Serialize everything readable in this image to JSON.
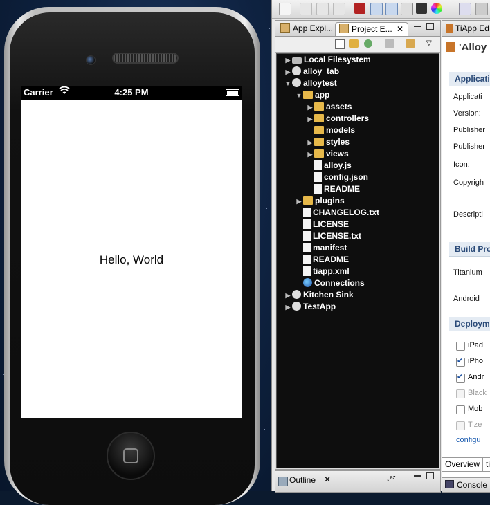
{
  "simulator": {
    "carrier": "Carrier",
    "time": "4:25 PM",
    "screen_text": "Hello, World"
  },
  "project_pane": {
    "tabs": [
      {
        "label": "App Expl..."
      },
      {
        "label": "Project E...",
        "close": "✕"
      }
    ],
    "tree": [
      {
        "label": "Local Filesystem",
        "depth": 0,
        "arrow": "▶",
        "icon": "disk"
      },
      {
        "label": "alloy_tab",
        "depth": 0,
        "arrow": "▶",
        "icon": "project"
      },
      {
        "label": "alloytest",
        "depth": 0,
        "arrow": "▼",
        "icon": "project"
      },
      {
        "label": "app",
        "depth": 1,
        "arrow": "▼",
        "icon": "folder"
      },
      {
        "label": "assets",
        "depth": 2,
        "arrow": "▶",
        "icon": "folder"
      },
      {
        "label": "controllers",
        "depth": 2,
        "arrow": "▶",
        "icon": "folder"
      },
      {
        "label": "models",
        "depth": 2,
        "arrow": "",
        "icon": "folder"
      },
      {
        "label": "styles",
        "depth": 2,
        "arrow": "▶",
        "icon": "folder"
      },
      {
        "label": "views",
        "depth": 2,
        "arrow": "▶",
        "icon": "folder"
      },
      {
        "label": "alloy.js",
        "depth": 2,
        "arrow": "",
        "icon": "file"
      },
      {
        "label": "config.json",
        "depth": 2,
        "arrow": "",
        "icon": "file"
      },
      {
        "label": "README",
        "depth": 2,
        "arrow": "",
        "icon": "file"
      },
      {
        "label": "plugins",
        "depth": 1,
        "arrow": "▶",
        "icon": "folder"
      },
      {
        "label": "CHANGELOG.txt",
        "depth": 1,
        "arrow": "",
        "icon": "file"
      },
      {
        "label": "LICENSE",
        "depth": 1,
        "arrow": "",
        "icon": "file"
      },
      {
        "label": "LICENSE.txt",
        "depth": 1,
        "arrow": "",
        "icon": "file"
      },
      {
        "label": "manifest",
        "depth": 1,
        "arrow": "",
        "icon": "file"
      },
      {
        "label": "README",
        "depth": 1,
        "arrow": "",
        "icon": "file"
      },
      {
        "label": "tiapp.xml",
        "depth": 1,
        "arrow": "",
        "icon": "file"
      },
      {
        "label": "Connections",
        "depth": 1,
        "arrow": "",
        "icon": "globe"
      },
      {
        "label": "Kitchen Sink",
        "depth": 0,
        "arrow": "▶",
        "icon": "project"
      },
      {
        "label": "TestApp",
        "depth": 0,
        "arrow": "▶",
        "icon": "project"
      }
    ]
  },
  "outline": {
    "label": "Outline",
    "close": "✕"
  },
  "editor": {
    "tab_label": "TiApp Ed",
    "title": "'Alloy",
    "sections": {
      "application": "Applicatio",
      "build": "Build Pro",
      "deployment": "Deployme"
    },
    "fields": [
      "Applicati",
      "Version:",
      "Publisher",
      "Publisher",
      "Icon:",
      "Copyrigh",
      "Descripti"
    ],
    "build_fields": [
      "Titanium",
      "Android"
    ],
    "targets": [
      {
        "label": "iPad",
        "checked": false,
        "disabled": false
      },
      {
        "label": "iPho",
        "checked": true,
        "disabled": false
      },
      {
        "label": "Andr",
        "checked": true,
        "disabled": false
      },
      {
        "label": "Black",
        "checked": false,
        "disabled": true
      },
      {
        "label": "Mob",
        "checked": false,
        "disabled": false
      },
      {
        "label": "Tize",
        "checked": false,
        "disabled": true
      }
    ],
    "configure_link": "configu",
    "bottom_tabs": [
      "Overview",
      "ti"
    ],
    "console": "Console"
  }
}
